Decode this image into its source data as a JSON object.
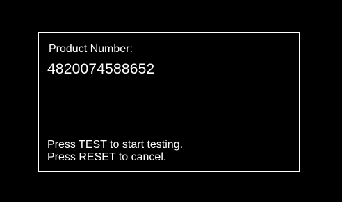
{
  "dialog": {
    "product_label": "Product Number:",
    "product_value": "4820074588652",
    "instructions": [
      "Press TEST to start testing.",
      "Press RESET to cancel."
    ]
  },
  "colors": {
    "background": "#000000",
    "foreground": "#ffffff",
    "border": "#ffffff"
  }
}
